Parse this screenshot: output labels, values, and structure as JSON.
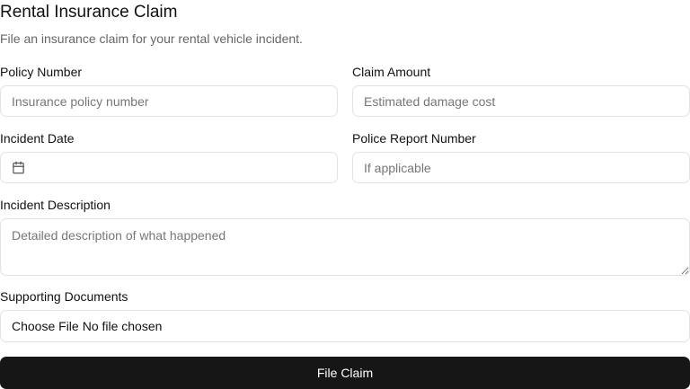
{
  "form": {
    "title": "Rental Insurance Claim",
    "subtitle": "File an insurance claim for your rental vehicle incident.",
    "policy_number": {
      "label": "Policy Number",
      "placeholder": "Insurance policy number",
      "value": ""
    },
    "claim_amount": {
      "label": "Claim Amount",
      "placeholder": "Estimated damage cost",
      "value": ""
    },
    "incident_date": {
      "label": "Incident Date",
      "value": "",
      "icon": "calendar-icon"
    },
    "police_report": {
      "label": "Police Report Number",
      "placeholder": "If applicable",
      "value": ""
    },
    "description": {
      "label": "Incident Description",
      "placeholder": "Detailed description of what happened",
      "value": ""
    },
    "documents": {
      "label": "Supporting Documents",
      "button_label": "Choose File",
      "status": "No file chosen"
    },
    "submit_label": "File Claim"
  }
}
